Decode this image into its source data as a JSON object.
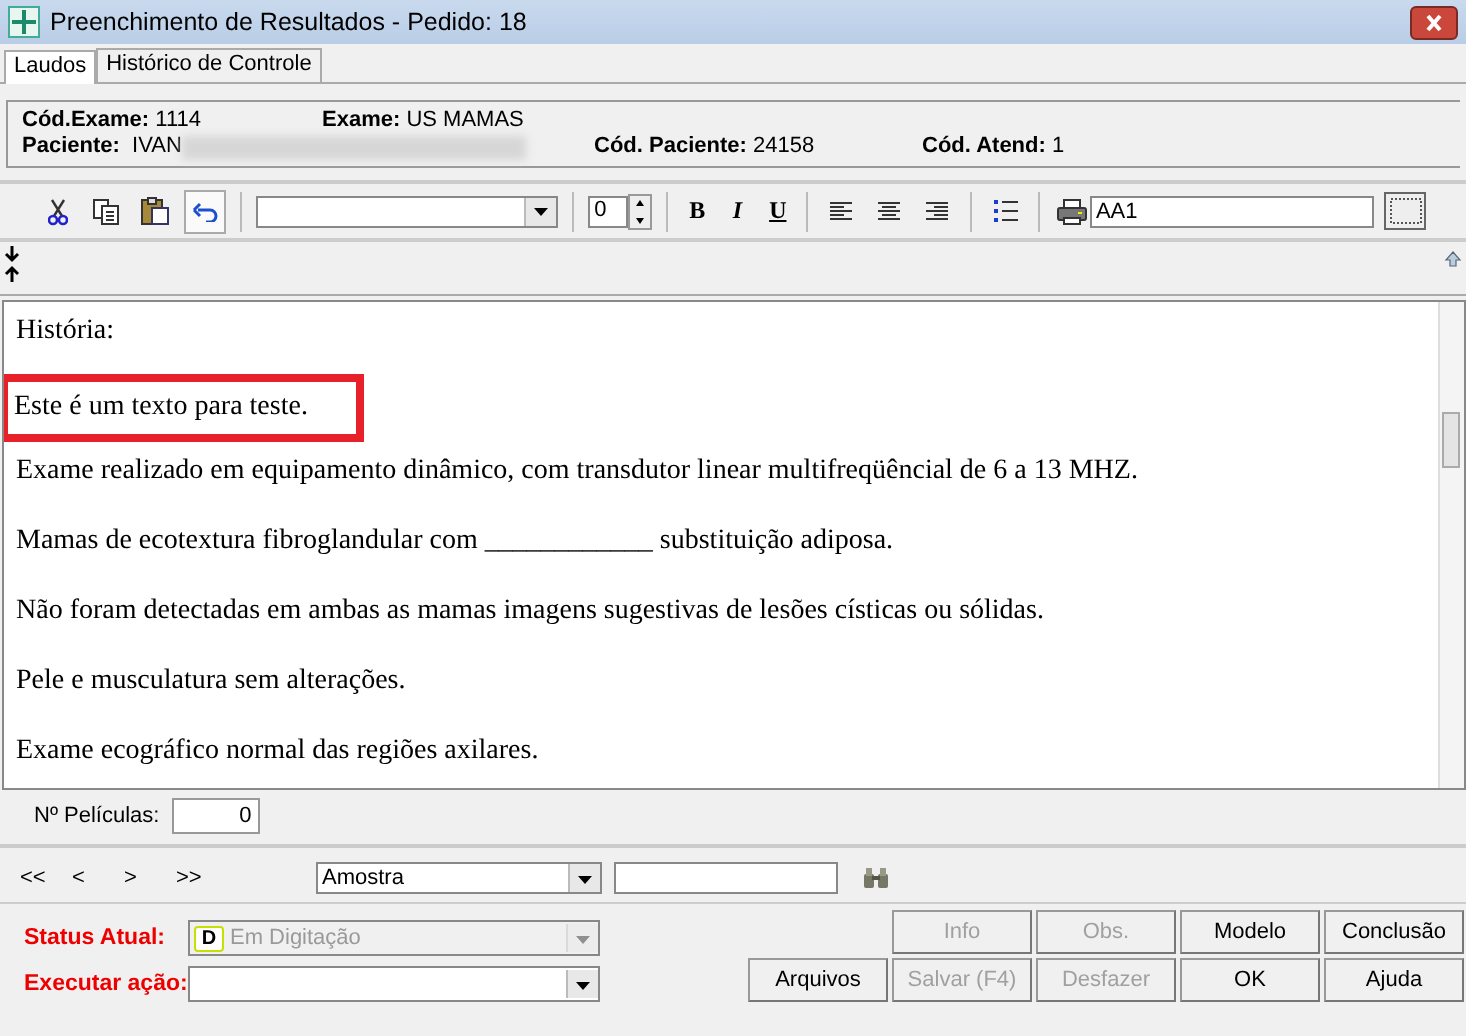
{
  "window": {
    "title": "Preenchimento de Resultados - Pedido: 18"
  },
  "tabs": [
    {
      "label": "Laudos",
      "selected": true
    },
    {
      "label": "Histórico de Controle",
      "selected": false
    }
  ],
  "info": {
    "cod_exame_label": "Cód.Exame:",
    "cod_exame": "1114",
    "exame_label": "Exame:",
    "exame": "US MAMAS",
    "paciente_label": "Paciente:",
    "paciente": "IVAN",
    "cod_paciente_label": "Cód. Paciente:",
    "cod_paciente": "24158",
    "cod_atend_label": "Cód. Atend:",
    "cod_atend": "1"
  },
  "toolbar": {
    "size": "0",
    "format_buttons": [
      "B",
      "I",
      "U"
    ],
    "print_field": "AA1"
  },
  "editor": {
    "paragraphs": [
      {
        "text": "História:",
        "highlighted": false
      },
      {
        "text": "Este é um texto para teste.",
        "highlighted": true
      },
      {
        "text": "Exame realizado em equipamento dinâmico, com transdutor linear multifreqüêncial de 6 a 13 MHZ.",
        "highlighted": false
      },
      {
        "text": "Mamas de ecotextura fibroglandular com ____________ substituição adiposa.",
        "highlighted": false
      },
      {
        "text": "Não foram detectadas em ambas as mamas imagens sugestivas de lesões císticas ou sólidas.",
        "highlighted": false
      },
      {
        "text": "Pele e musculatura sem alterações.",
        "highlighted": false
      },
      {
        "text": "Exame ecográfico normal das regiões axilares.",
        "highlighted": false
      }
    ]
  },
  "peliculas": {
    "label": "Nº Películas:",
    "value": "0"
  },
  "navigation": {
    "buttons": [
      "<<",
      "<",
      ">",
      ">>"
    ],
    "combo": "Amostra"
  },
  "status": {
    "label": "Status Atual:",
    "value": "Em Digitação",
    "badge": "D",
    "action_label": "Executar ação:"
  },
  "button_rows": [
    [
      {
        "label": "Info",
        "disabled": true
      },
      {
        "label": "Obs.",
        "disabled": true
      },
      {
        "label": "Modelo",
        "disabled": false
      },
      {
        "label": "Conclusão",
        "disabled": false
      }
    ],
    [
      {
        "label": "Arquivos",
        "disabled": false
      },
      {
        "label": "Salvar (F4)",
        "disabled": true
      },
      {
        "label": "Desfazer",
        "disabled": true
      },
      {
        "label": "OK",
        "disabled": false
      },
      {
        "label": "Ajuda",
        "disabled": false
      }
    ]
  ]
}
